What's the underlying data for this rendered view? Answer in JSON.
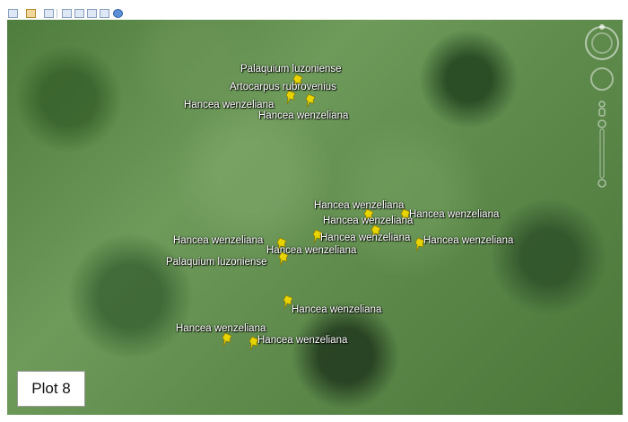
{
  "toolbar": {
    "buttons": [
      "hide-sidebar-icon",
      "add-placemark-icon",
      "add-polygon-icon",
      "email-icon",
      "print-icon",
      "save-image-icon",
      "ruler-icon",
      "earth-icon"
    ]
  },
  "map": {
    "placemarks": [
      {
        "label": "Palaquium luzoniense",
        "color": "#e8d400"
      },
      {
        "label": "Artocarpus rubrovenius",
        "color": "#e8d400"
      },
      {
        "label": "Hancea wenzeliana",
        "color": "#e8d400"
      },
      {
        "label": "Hancea wenzeliana",
        "color": "#e8d400"
      },
      {
        "label": "Hancea wenzeliana",
        "color": "#e8d400"
      },
      {
        "label": "Hancea wenzeliana",
        "color": "#e8d400"
      },
      {
        "label": "Hancea wenzeliana",
        "color": "#e8d400"
      },
      {
        "label": "Hancea wenzeliana",
        "color": "#e8d400"
      },
      {
        "label": "Hancea wenzeliana",
        "color": "#e8d400"
      },
      {
        "label": "Hancea wenzeliana",
        "color": "#e8d400"
      },
      {
        "label": "Hancea wenzeliana",
        "color": "#e8d400"
      },
      {
        "label": "Palaquium luzoniense",
        "color": "#e8d400"
      },
      {
        "label": "Hancea wenzeliana",
        "color": "#e8d400"
      },
      {
        "label": "Hancea wenzeliana",
        "color": "#e8d400"
      },
      {
        "label": "Hancea wenzeliana",
        "color": "#e8d400"
      }
    ]
  },
  "plot_label": "Plot 8"
}
